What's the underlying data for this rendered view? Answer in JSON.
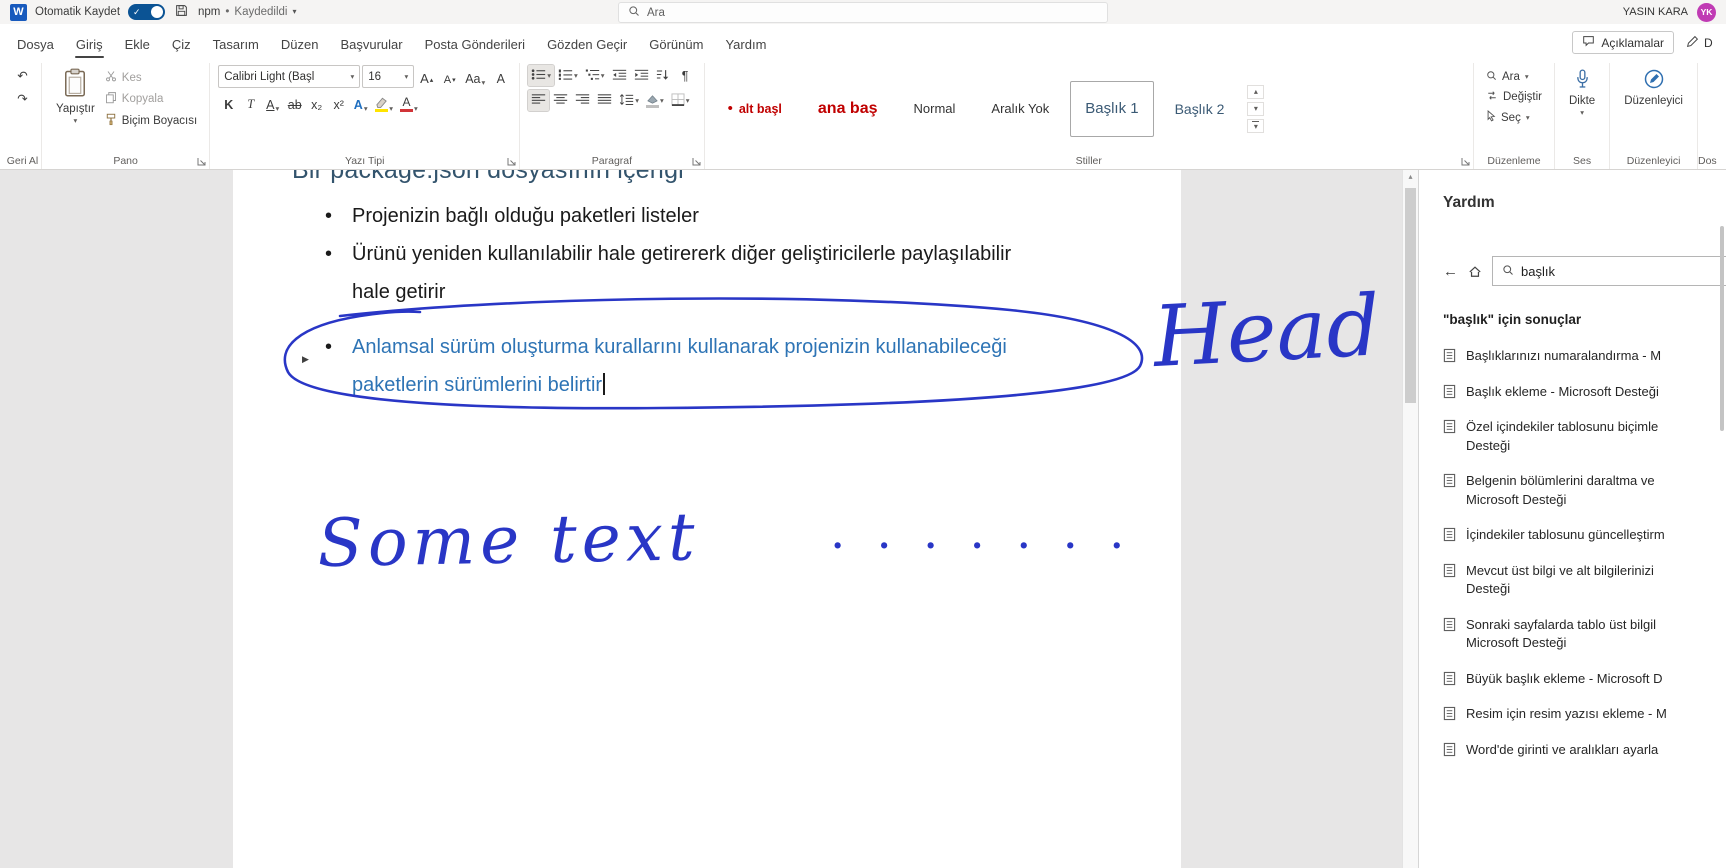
{
  "icons": {
    "chevron_down": "▾",
    "triangle_up": "▴",
    "triangle_down": "▾",
    "back_arrow": "←",
    "check": "✓",
    "undo": "↶",
    "redo": "↷",
    "pilcrow": "¶",
    "bullet_dot": "•",
    "collapse_triangle": "▶"
  },
  "colors": {
    "accent_blue": "#185abd",
    "ink_blue": "#2936c6",
    "doc_blue": "#2e74b5",
    "style_red": "#c00000",
    "heading_gray_blue": "#3b5a75",
    "normal_text": "#333333",
    "highlight_yellow": "#ffe400",
    "font_color_red": "#d13438",
    "avatar_purple": "#c03bb4"
  },
  "titlebar": {
    "app_initial": "W",
    "autosave_label": "Otomatik Kaydet",
    "doc_name": "npm",
    "separator": "•",
    "doc_status": "Kaydedildi",
    "search_placeholder": "Ara",
    "user_name": "YASIN KARA",
    "user_initials": "YK"
  },
  "tabs": {
    "items": [
      {
        "label": "Dosya"
      },
      {
        "label": "Giriş",
        "active": true
      },
      {
        "label": "Ekle"
      },
      {
        "label": "Çiz"
      },
      {
        "label": "Tasarım"
      },
      {
        "label": "Düzen"
      },
      {
        "label": "Başvurular"
      },
      {
        "label": "Posta Gönderileri"
      },
      {
        "label": "Gözden Geçir"
      },
      {
        "label": "Görünüm"
      },
      {
        "label": "Yardım"
      }
    ],
    "comments_label": "Açıklamalar",
    "editing_partial": "D"
  },
  "ribbon": {
    "undo_group": {
      "label": "Geri Al"
    },
    "clipboard": {
      "label": "Pano",
      "paste": "Yapıştır",
      "cut": "Kes",
      "copy": "Kopyala",
      "format_painter": "Biçim Boyacısı"
    },
    "font": {
      "label": "Yazı Tipi",
      "family": "Calibri Light (Başl",
      "size": "16",
      "grow": "A",
      "shrink": "A",
      "case_btn": "Aa",
      "clear": "A",
      "bold": "K",
      "italic": "T",
      "underline": "A",
      "strike": "ab",
      "subscript": "x₂",
      "superscript": "x²",
      "effects": "A",
      "font_color": "A"
    },
    "paragraph": {
      "label": "Paragraf"
    },
    "styles": {
      "label": "Stiller",
      "items": [
        {
          "label": "alt başl",
          "color": "#c00000",
          "bullet": true
        },
        {
          "label": "ana baş",
          "color": "#c00000"
        },
        {
          "label": "Normal",
          "color": "#333333"
        },
        {
          "label": "Aralık Yok",
          "color": "#333333"
        },
        {
          "label": "Başlık 1",
          "color": "#3b5a75",
          "selected": true
        },
        {
          "label": "Başlık 2",
          "color": "#3b5a75"
        }
      ]
    },
    "editing": {
      "label": "Düzenleme",
      "find": "Ara",
      "replace": "Değiştir",
      "select": "Seç"
    },
    "voice": {
      "label": "Ses",
      "dictate": "Dikte"
    },
    "editor": {
      "label": "Düzenleyici",
      "button": "Düzenleyici"
    },
    "overflow_label": "Dos"
  },
  "document": {
    "clipped_heading": "Bir package.json dosyasının içeriği",
    "bullets": [
      "Projenizin bağlı olduğu paketleri listeler",
      "Ürünü yeniden kullanılabilir hale getirererk diğer geliştiricilerle paylaşılabilir hale getirir"
    ],
    "blue_bullet": "Anlamsal sürüm oluşturma kurallarını kullanarak projenizin kullanabileceği paketlerin sürümlerini belirtir",
    "ink": {
      "word1": "Head",
      "word2": "Some text",
      "dots": ". . . .  . . ."
    }
  },
  "help": {
    "title": "Yardım",
    "search_value": "başlık",
    "results_header": "\"başlık\" için sonuçlar",
    "results": [
      {
        "lines": [
          "Başlıklarınızı numaralandırma - M"
        ]
      },
      {
        "lines": [
          "Başlık ekleme - Microsoft Desteği"
        ]
      },
      {
        "lines": [
          "Özel içindekiler tablosunu biçimle",
          "Desteği"
        ]
      },
      {
        "lines": [
          "Belgenin bölümlerini daraltma ve",
          "Microsoft Desteği"
        ]
      },
      {
        "lines": [
          "İçindekiler tablosunu güncelleştirm"
        ]
      },
      {
        "lines": [
          "Mevcut üst bilgi ve alt bilgilerinizi",
          "Desteği"
        ]
      },
      {
        "lines": [
          "Sonraki sayfalarda tablo üst bilgil",
          "Microsoft Desteği"
        ]
      },
      {
        "lines": [
          "Büyük başlık ekleme - Microsoft D"
        ]
      },
      {
        "lines": [
          "Resim için resim yazısı ekleme - M"
        ]
      },
      {
        "lines": [
          "Word'de girinti ve aralıkları ayarla"
        ]
      }
    ]
  }
}
